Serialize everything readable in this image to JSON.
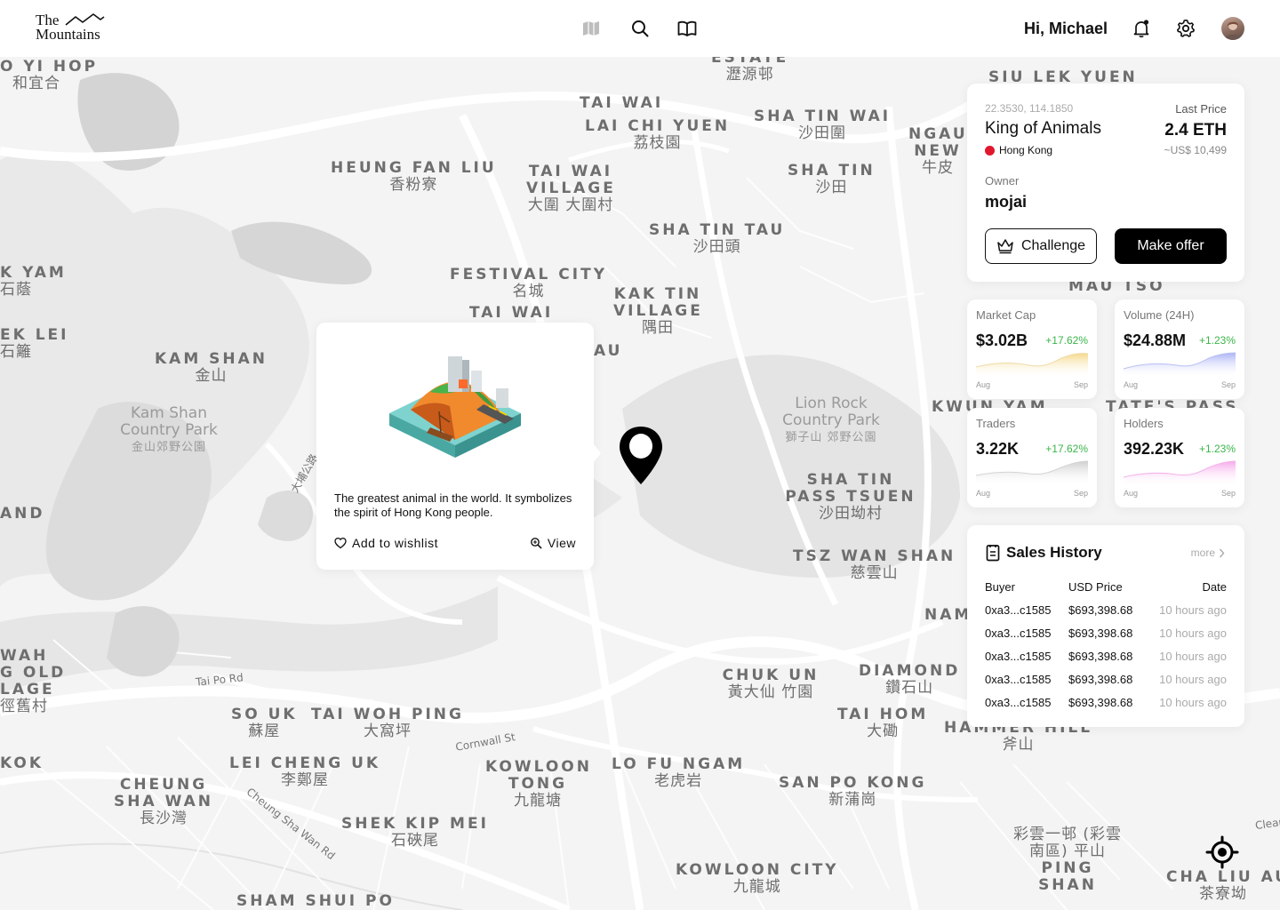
{
  "header": {
    "logo_line1": "The",
    "logo_line2": "Mountains",
    "greeting": "Hi, Michael",
    "nav": [
      "map-icon",
      "search-icon",
      "book-icon"
    ],
    "icons": [
      "bell-icon",
      "gear-icon",
      "avatar"
    ]
  },
  "map": {
    "labels": [
      {
        "en": "O YI HOP",
        "zh": "和宜合"
      },
      {
        "en": "TAI WAI",
        "zh": ""
      },
      {
        "en": "LAI CHI YUEN",
        "zh": "荔枝園"
      },
      {
        "en": "SHA TIN WAI",
        "zh": "沙田圍"
      },
      {
        "en": "SIU LEK YUEN",
        "zh": ""
      },
      {
        "en": "HEUNG FAN LIU",
        "zh": "香粉寮"
      },
      {
        "en": "TAI WAI VILLAGE",
        "zh": "大圍 大圍村"
      },
      {
        "en": "SHA TIN",
        "zh": "沙田"
      },
      {
        "en": "NGAU NEW",
        "zh": "牛皮"
      },
      {
        "en": "SHA TIN TAU",
        "zh": "沙田頭"
      },
      {
        "en": "FESTIVAL CITY",
        "zh": "名城"
      },
      {
        "en": "KAK TIN VILLAGE",
        "zh": "隅田"
      },
      {
        "en": "TAI WAI",
        "zh": ""
      },
      {
        "en": "K YAM",
        "zh": "石蔭"
      },
      {
        "en": "EK LEI",
        "zh": "石籬"
      },
      {
        "en": "KAM SHAN",
        "zh": "金山"
      },
      {
        "en": "AU",
        "zh": ""
      },
      {
        "en": "SHA TIN PASS TSUEN",
        "zh": "沙田坳村"
      },
      {
        "en": "TSZ WAN SHAN",
        "zh": "慈雲山"
      },
      {
        "en": "AND",
        "zh": ""
      },
      {
        "en": "WAH G OLD LAGE",
        "zh": "徑舊村"
      },
      {
        "en": "SO UK",
        "zh": "蘇屋"
      },
      {
        "en": "TAI WOH PING",
        "zh": "大窩坪"
      },
      {
        "en": "CHUK UN",
        "zh": "黃大仙 竹園"
      },
      {
        "en": "DIAMOND",
        "zh": "鑽石山"
      },
      {
        "en": "TAI HOM",
        "zh": "大磡"
      },
      {
        "en": "HAMMER HILL",
        "zh": "斧山"
      },
      {
        "en": "KOK",
        "zh": ""
      },
      {
        "en": "LEI CHENG UK",
        "zh": "李鄭屋"
      },
      {
        "en": "KOWLOON TONG",
        "zh": "九龍塘"
      },
      {
        "en": "LO FU NGAM",
        "zh": "老虎岩"
      },
      {
        "en": "SAN PO KONG",
        "zh": "新蒲崗"
      },
      {
        "en": "CHEUNG SHA WAN",
        "zh": "長沙灣"
      },
      {
        "en": "SHEK KIP MEI",
        "zh": "石硤尾"
      },
      {
        "en": "KOWLOON CITY",
        "zh": "九龍城"
      },
      {
        "en": "PING SHAN",
        "zh": "彩雲一邨 (彩雲南區) 平山"
      },
      {
        "en": "CHA LIU AU",
        "zh": "茶寮坳"
      },
      {
        "en": "SHAM SHUI PO",
        "zh": ""
      },
      {
        "en": "NAM",
        "zh": ""
      },
      {
        "en": "KWUN YAM",
        "zh": ""
      },
      {
        "en": "TATE'S PASS",
        "zh": ""
      },
      {
        "en": "MAU TSO",
        "zh": ""
      },
      {
        "en": "ESTATE",
        "zh": "瀝源邨"
      }
    ],
    "parks": [
      {
        "en": "Kam Shan Country Park",
        "zh": "金山郊野公園"
      },
      {
        "en": "Lion Rock Country Park",
        "zh": "獅子山 郊野公園"
      }
    ],
    "roads": [
      "Tai Po Rd",
      "Cornwall St",
      "Cheung Sha Wan Rd",
      "大埔公路",
      "Clear"
    ]
  },
  "popup": {
    "description": "The greatest animal in the world. It symbolizes the spirit of Hong Kong people.",
    "wishlist_label": "Add to wishlist",
    "view_label": "View"
  },
  "info": {
    "coords": "22.3530, 114.1850",
    "title": "King of Animals",
    "location": "Hong Kong",
    "last_price_label": "Last Price",
    "last_price": "2.4 ETH",
    "usd_price": "~US$ 10,499",
    "owner_label": "Owner",
    "owner": "mojai",
    "challenge_label": "Challenge",
    "offer_label": "Make offer"
  },
  "stats": [
    {
      "label": "Market Cap",
      "value": "$3.02B",
      "change": "+17.62%",
      "from": "Aug",
      "to": "Sep",
      "color": "#f5d98a"
    },
    {
      "label": "Volume (24H)",
      "value": "$24.88M",
      "change": "+1.23%",
      "from": "Aug",
      "to": "Sep",
      "color": "#a9b3f5"
    },
    {
      "label": "Traders",
      "value": "3.22K",
      "change": "+17.62%",
      "from": "Aug",
      "to": "Sep",
      "color": "#d0d0d0"
    },
    {
      "label": "Holders",
      "value": "392.23K",
      "change": "+1.23%",
      "from": "Aug",
      "to": "Sep",
      "color": "#f7a8ec"
    }
  ],
  "sales": {
    "title": "Sales History",
    "more": "more",
    "headers": [
      "Buyer",
      "USD Price",
      "Date"
    ],
    "rows": [
      [
        "0xa3...c1585",
        "$693,398.68",
        "10 hours ago"
      ],
      [
        "0xa3...c1585",
        "$693,398.68",
        "10 hours ago"
      ],
      [
        "0xa3...c1585",
        "$693,398.68",
        "10 hours ago"
      ],
      [
        "0xa3...c1585",
        "$693,398.68",
        "10 hours ago"
      ],
      [
        "0xa3...c1585",
        "$693,398.68",
        "10 hours ago"
      ]
    ]
  }
}
